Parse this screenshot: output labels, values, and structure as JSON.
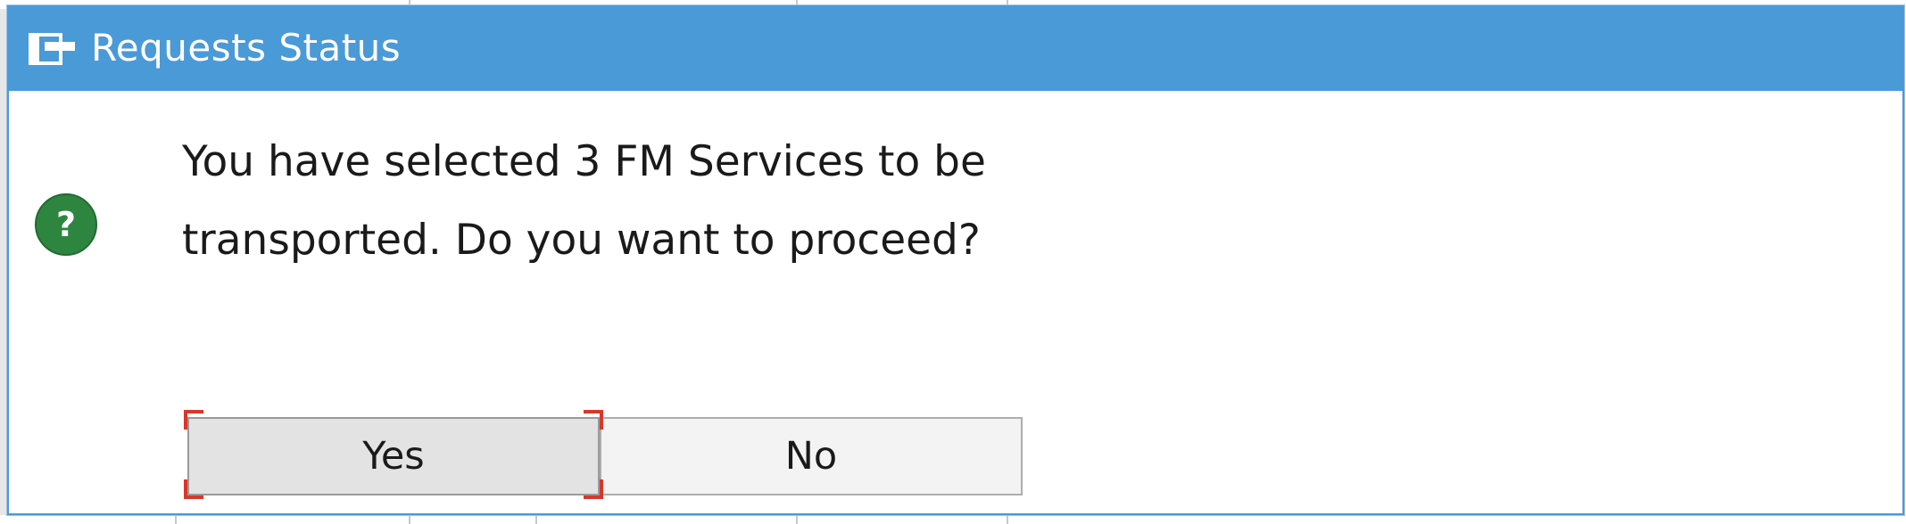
{
  "dialog": {
    "title": "Requests Status",
    "message_line1": "You have selected 3 FM Services to be",
    "message_line2": "transported. Do you want to proceed?",
    "icon": "question-icon",
    "title_icon": "window-icon"
  },
  "buttons": {
    "yes_label": "Yes",
    "no_label": "No"
  },
  "colors": {
    "titlebar": "#4a9ad8",
    "question_icon": "#2e8540",
    "focus_indicator": "#d9372b"
  }
}
